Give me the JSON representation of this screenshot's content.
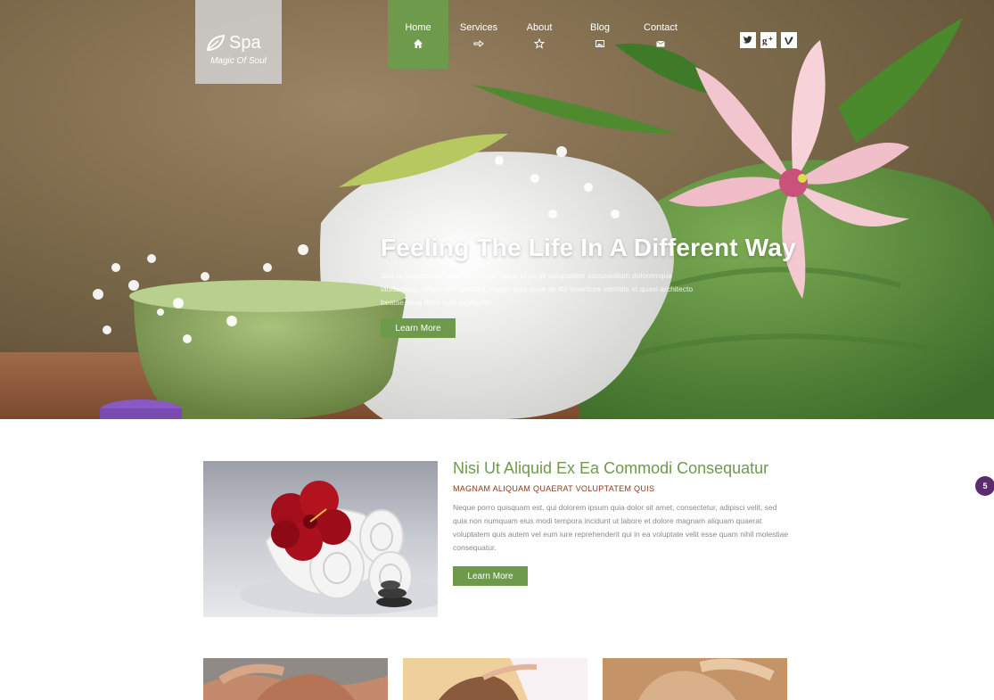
{
  "brand": {
    "title": "Spa",
    "tagline": "Magic Of Soul",
    "logo_icon": "leaf-icon"
  },
  "nav": {
    "items": [
      {
        "label": "Home",
        "icon": "home-icon",
        "active": true
      },
      {
        "label": "Services",
        "icon": "hand-pointer-icon",
        "active": false
      },
      {
        "label": "About",
        "icon": "star-icon",
        "active": false
      },
      {
        "label": "Blog",
        "icon": "picture-icon",
        "active": false
      },
      {
        "label": "Contact",
        "icon": "envelope-icon",
        "active": false
      }
    ]
  },
  "social": [
    "twitter-icon",
    "google-plus-icon",
    "vimeo-icon"
  ],
  "hero": {
    "title": "Feeling The Life In A Different Way",
    "text": "Sed ut perspiciatis unde omnis iste natus error sit voluptatem accusantium doloremque laudantium, totam rem aperiam, eaque ipsa quae ab illo inventore veritatis et quasi architecto beatae vitae dicta sunt explicabo.",
    "button": "Learn More"
  },
  "feature": {
    "title": "Nisi Ut Aliquid Ex Ea Commodi Consequatur",
    "subtitle": "MAGNAM ALIQUAM QUAERAT VOLUPTATEM QUIS",
    "text": "Neque porro quisquam est, qui dolorem ipsum quia dolor sit amet, consectetur, adipisci velit, sed quia non numquam eius modi tempora incidunt ut labore et dolore magnam aliquam quaerat voluptatem quis autem vel eum iure reprehenderit qui in ea voluptate velit esse quam nihil molestiae consequatur.",
    "button": "Learn More"
  },
  "badge": {
    "count": "5"
  },
  "colors": {
    "accent": "#6e9a4c",
    "subtitle": "#8a3a1a",
    "badge": "#5b2b6b"
  }
}
